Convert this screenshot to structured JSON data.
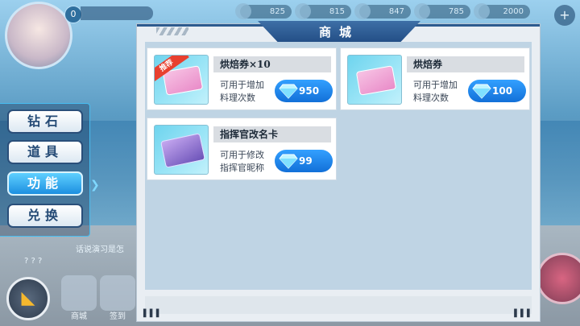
{
  "player": {
    "level": "0",
    "name": ""
  },
  "resources": [
    {
      "icon": "energy-icon",
      "value": "825"
    },
    {
      "icon": "coin-icon",
      "value": "815"
    },
    {
      "icon": "food-icon",
      "value": "847"
    },
    {
      "icon": "material-icon",
      "value": "785"
    },
    {
      "icon": "diamond-icon",
      "value": "2000"
    }
  ],
  "menu": {
    "tabs": [
      {
        "label": "钻石",
        "active": false
      },
      {
        "label": "道具",
        "active": false
      },
      {
        "label": "功能",
        "active": true
      },
      {
        "label": "兑换",
        "active": false
      }
    ]
  },
  "chat": {
    "line1": "话说演习是怎",
    "line2": "? ? ?"
  },
  "bottom_nav": [
    {
      "label": "商城"
    },
    {
      "label": "签到"
    }
  ],
  "shop": {
    "title": "商城",
    "items": [
      {
        "name": "烘焙券×10",
        "desc": "可用于增加料理次数",
        "price": "950",
        "badge": "推荐"
      },
      {
        "name": "烘焙券",
        "desc": "可用于增加料理次数",
        "price": "100",
        "badge": ""
      },
      {
        "name": "指挥官改名卡",
        "desc": "可用于修改指挥官昵称",
        "price": "99",
        "badge": ""
      }
    ]
  },
  "colors": {
    "accent": "#1c8fe0",
    "price_button": "#1270d8",
    "badge": "#e8402f"
  }
}
